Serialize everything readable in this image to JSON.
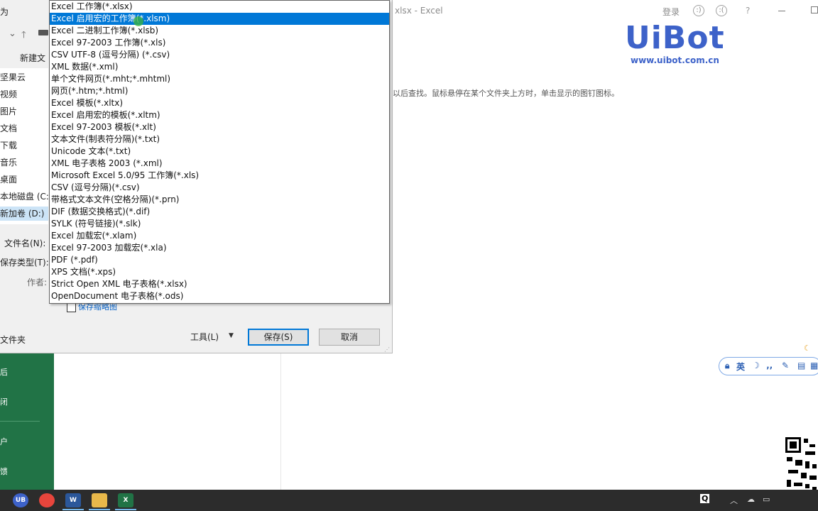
{
  "excel": {
    "doc_title": "xlsx  -  Excel",
    "login": "登录",
    "help": "?",
    "hint": "以后查找。鼠标悬停在某个文件夹上方时，单击显示的图钉图标。",
    "rail_items": [
      "后",
      "闭",
      "户",
      "馈"
    ]
  },
  "logo": {
    "main": "UiBot",
    "url": "www.uibot.com.cn"
  },
  "dialog": {
    "title": "为",
    "new_folder": "新建文",
    "nav_items": [
      "坚果云",
      "视频",
      "图片",
      "文档",
      "下载",
      "音乐",
      "桌面",
      "本地磁盘 (C:)",
      "新加卷 (D:)"
    ],
    "filename_label": "文件名(N):",
    "filetype_label": "保存类型(T):",
    "author_label": "作者:",
    "thumbnail_label": "保存缩略图",
    "folder_toggle": "文件夹",
    "tools_label": "工具(L)",
    "save_button": "保存(S)",
    "cancel_button": "取消"
  },
  "dropdown": {
    "selected_index": 1,
    "options": [
      "Excel 工作簿(*.xlsx)",
      "Excel 启用宏的工作簿(*.xlsm)",
      "Excel 二进制工作簿(*.xlsb)",
      "Excel 97-2003 工作簿(*.xls)",
      "CSV UTF-8 (逗号分隔) (*.csv)",
      "XML 数据(*.xml)",
      "单个文件网页(*.mht;*.mhtml)",
      "网页(*.htm;*.html)",
      "Excel 模板(*.xltx)",
      "Excel 启用宏的模板(*.xltm)",
      "Excel 97-2003 模板(*.xlt)",
      "文本文件(制表符分隔)(*.txt)",
      "Unicode 文本(*.txt)",
      "XML 电子表格 2003 (*.xml)",
      "Microsoft Excel 5.0/95 工作簿(*.xls)",
      "CSV (逗号分隔)(*.csv)",
      "带格式文本文件(空格分隔)(*.prn)",
      "DIF (数据交换格式)(*.dif)",
      "SYLK (符号链接)(*.slk)",
      "Excel 加载宏(*.xlam)",
      "Excel 97-2003 加载宏(*.xla)",
      "PDF (*.pdf)",
      "XPS 文档(*.xps)",
      "Strict Open XML 电子表格(*.xlsx)",
      "OpenDocument 电子表格(*.ods)"
    ]
  },
  "ime": {
    "lang": "英"
  },
  "taskbar": {
    "apps": [
      {
        "label": "UB",
        "color": "#3d62c9"
      },
      {
        "label": "",
        "color": "#e8453c"
      },
      {
        "label": "W",
        "color": "#2b579a"
      },
      {
        "label": "",
        "color": "#e8b84a"
      },
      {
        "label": "X",
        "color": "#217346"
      }
    ]
  },
  "colors": {
    "accent": "#0078d7",
    "excel_green": "#217346",
    "uibot_blue": "#3d62c9"
  }
}
